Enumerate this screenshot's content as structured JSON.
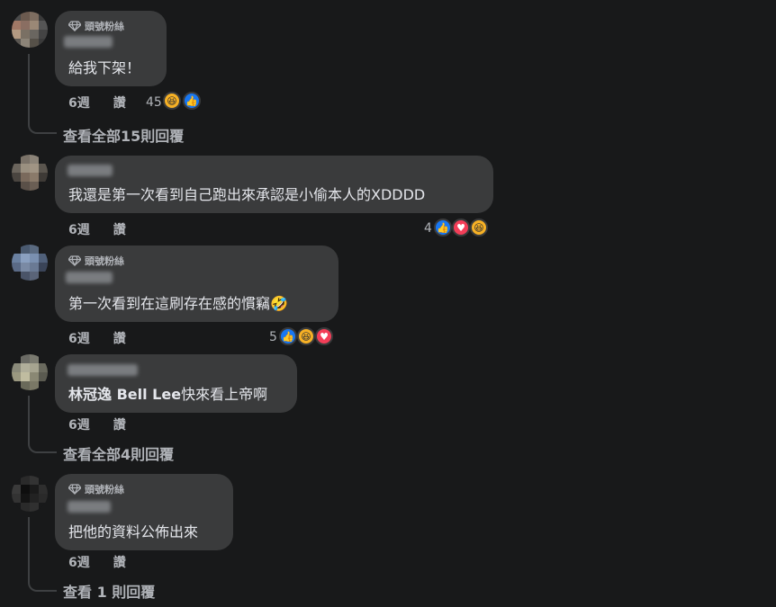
{
  "badge_label": "頭號粉絲",
  "like_label": "讚",
  "comments": [
    {
      "text": "給我下架！",
      "time": "6週",
      "reaction_count": "45",
      "reactions": [
        "haha",
        "like"
      ],
      "view_replies": "查看全部15則回覆",
      "has_badge": true
    },
    {
      "text": "我還是第一次看到自己跑出來承認是小偷本人的XDDDD",
      "time": "6週",
      "reaction_count": "4",
      "reactions": [
        "like",
        "love",
        "haha"
      ],
      "has_badge": false
    },
    {
      "text": "第一次看到在這刷存在感的慣竊",
      "emoji": "🤣",
      "time": "6週",
      "reaction_count": "5",
      "reactions": [
        "like",
        "haha",
        "love"
      ],
      "has_badge": true
    },
    {
      "mention": "林冠逸 Bell Lee",
      "text": "快來看上帝啊",
      "time": "6週",
      "view_replies": "查看全部4則回覆",
      "has_badge": false
    },
    {
      "text": "把他的資料公佈出來",
      "time": "6週",
      "view_replies": "查看 1 則回覆",
      "has_badge": true
    }
  ],
  "colors": {
    "background": "#18191a",
    "bubble": "#3a3b3c",
    "like": "#1877f2",
    "love": "#f33e58",
    "haha": "#f7b125"
  }
}
